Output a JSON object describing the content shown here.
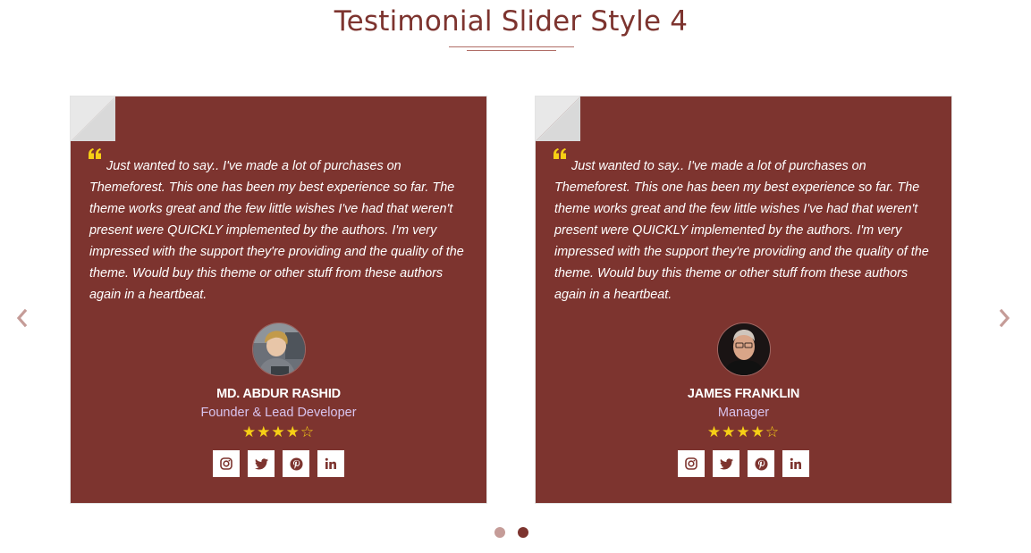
{
  "page": {
    "title": "Testimonial Slider Style 4"
  },
  "colors": {
    "accent": "#7d342f",
    "title": "#7d342f",
    "role_text": "#d8c4ee",
    "star": "#f6cf15",
    "dot_inactive": "#c59c98",
    "dot_active": "#7d342f",
    "arrow": "#c59c98"
  },
  "navigation": {
    "prev_icon": "chevron-left-icon",
    "next_icon": "chevron-right-icon"
  },
  "testimonials": [
    {
      "quote": "Just wanted to say.. I've made a lot of purchases on Themeforest. This one has been my best experience so far. The theme works great and the few little wishes I've had that weren't present were QUICKLY implemented by the authors. I'm very impressed with the support they're providing and the quality of the theme. Would buy this theme or other stuff from these authors again in a heartbeat.",
      "name": "MD. ABDUR RASHID",
      "role": "Founder & Lead Developer",
      "rating": 4,
      "rating_max": 5,
      "stars_text": "★★★★☆",
      "socials": [
        "instagram-icon",
        "twitter-icon",
        "pinterest-icon",
        "linkedin-icon"
      ]
    },
    {
      "quote": "Just wanted to say.. I've made a lot of purchases on Themeforest. This one has been my best experience so far. The theme works great and the few little wishes I've had that weren't present were QUICKLY implemented by the authors. I'm very impressed with the support they're providing and the quality of the theme. Would buy this theme or other stuff from these authors again in a heartbeat.",
      "name": "JAMES FRANKLIN",
      "role": "Manager",
      "rating": 4,
      "rating_max": 5,
      "stars_text": "★★★★☆",
      "socials": [
        "instagram-icon",
        "twitter-icon",
        "pinterest-icon",
        "linkedin-icon"
      ]
    }
  ],
  "pagination": {
    "count": 2,
    "active_index": 1
  }
}
